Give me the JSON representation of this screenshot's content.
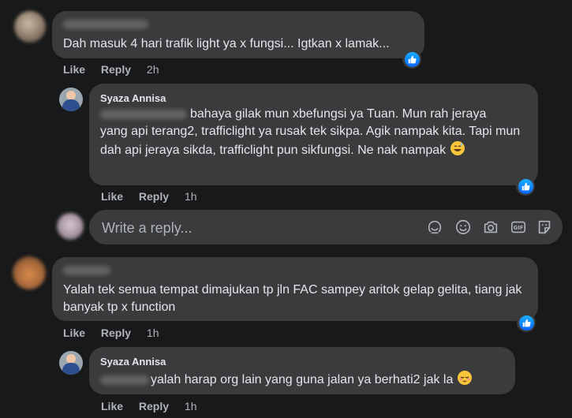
{
  "comments": [
    {
      "author": "",
      "text": "Dah masuk 4 hari trafik light ya x fungsi... Igtkan x lamak...",
      "actions": {
        "like": "Like",
        "reply": "Reply",
        "time": "2h"
      }
    },
    {
      "author": "Syaza Annisa",
      "text_line1": "bahaya gilak mun xbefungsi ya Tuan. Mun rah jeraya",
      "text_rest": "yang api terang2, trafficlight ya rusak tek sikpa. Agik nampak kita. Tapi mun dah api jeraya sikda, trafficlight pun sikfungsi. Ne nak nampak",
      "actions": {
        "like": "Like",
        "reply": "Reply",
        "time": "1h"
      }
    },
    {
      "author": "",
      "text": "Yalah tek semua tempat dimajukan tp jln FAC sampey aritok gelap gelita, tiang jak banyak tp x function",
      "actions": {
        "like": "Like",
        "reply": "Reply",
        "time": "1h"
      }
    },
    {
      "author": "Syaza Annisa",
      "text": "yalah harap org lain yang guna jalan ya berhati2 jak la",
      "actions": {
        "like": "Like",
        "reply": "Reply",
        "time": "1h"
      }
    }
  ],
  "reply_box": {
    "placeholder": "Write a reply...",
    "tools": [
      "avatar-sticker-icon",
      "emoji-icon",
      "camera-icon",
      "gif-icon",
      "sticker-icon"
    ]
  },
  "colors": {
    "background": "#18191a",
    "bubble": "#3a3b3c",
    "text": "#e4e6eb",
    "secondary_text": "#b0b3b8",
    "like_blue": "#0866ff"
  }
}
